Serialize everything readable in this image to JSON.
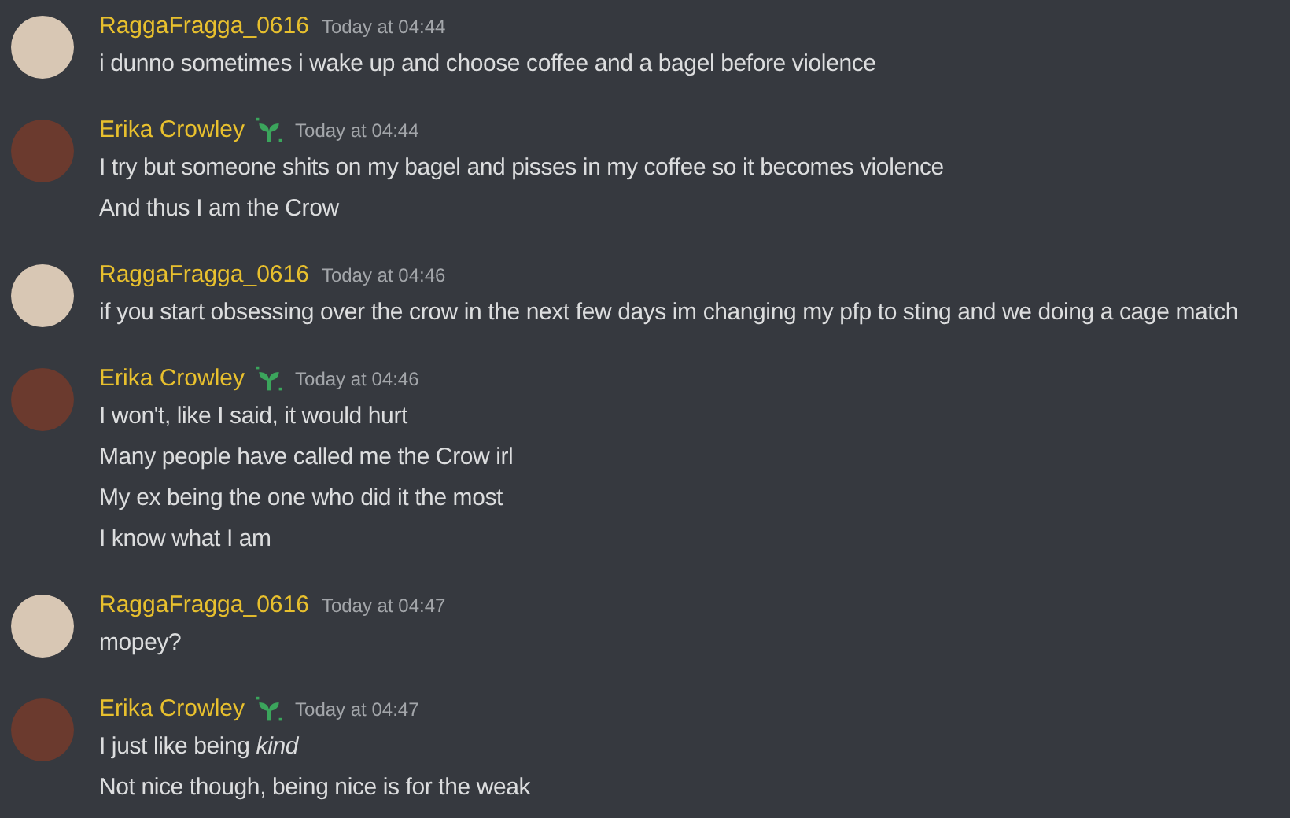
{
  "messages": [
    {
      "author": "RaggaFragga_0616",
      "badge": false,
      "timestamp": "Today at 04:44",
      "lines": [
        "i dunno sometimes i wake up and choose coffee and a bagel before violence"
      ]
    },
    {
      "author": "Erika Crowley",
      "badge": true,
      "timestamp": "Today at 04:44",
      "lines": [
        "I try but someone shits on my bagel and pisses in my coffee so it becomes violence",
        "And thus I am the Crow"
      ]
    },
    {
      "author": "RaggaFragga_0616",
      "badge": false,
      "timestamp": "Today at 04:46",
      "lines": [
        "if you start obsessing over the crow in the next few days im changing my pfp to sting and we doing a cage match"
      ]
    },
    {
      "author": "Erika Crowley",
      "badge": true,
      "timestamp": "Today at 04:46",
      "lines": [
        "I won't, like I said, it would hurt",
        "Many people have called me the Crow irl",
        "My ex being the one who did it the most",
        "I know what I am"
      ]
    },
    {
      "author": "RaggaFragga_0616",
      "badge": false,
      "timestamp": "Today at 04:47",
      "lines": [
        "mopey?"
      ]
    },
    {
      "author": "Erika Crowley",
      "badge": true,
      "timestamp": "Today at 04:47",
      "lines": [
        "I just like being *kind*",
        "Not nice though, being nice is for the weak"
      ]
    }
  ]
}
